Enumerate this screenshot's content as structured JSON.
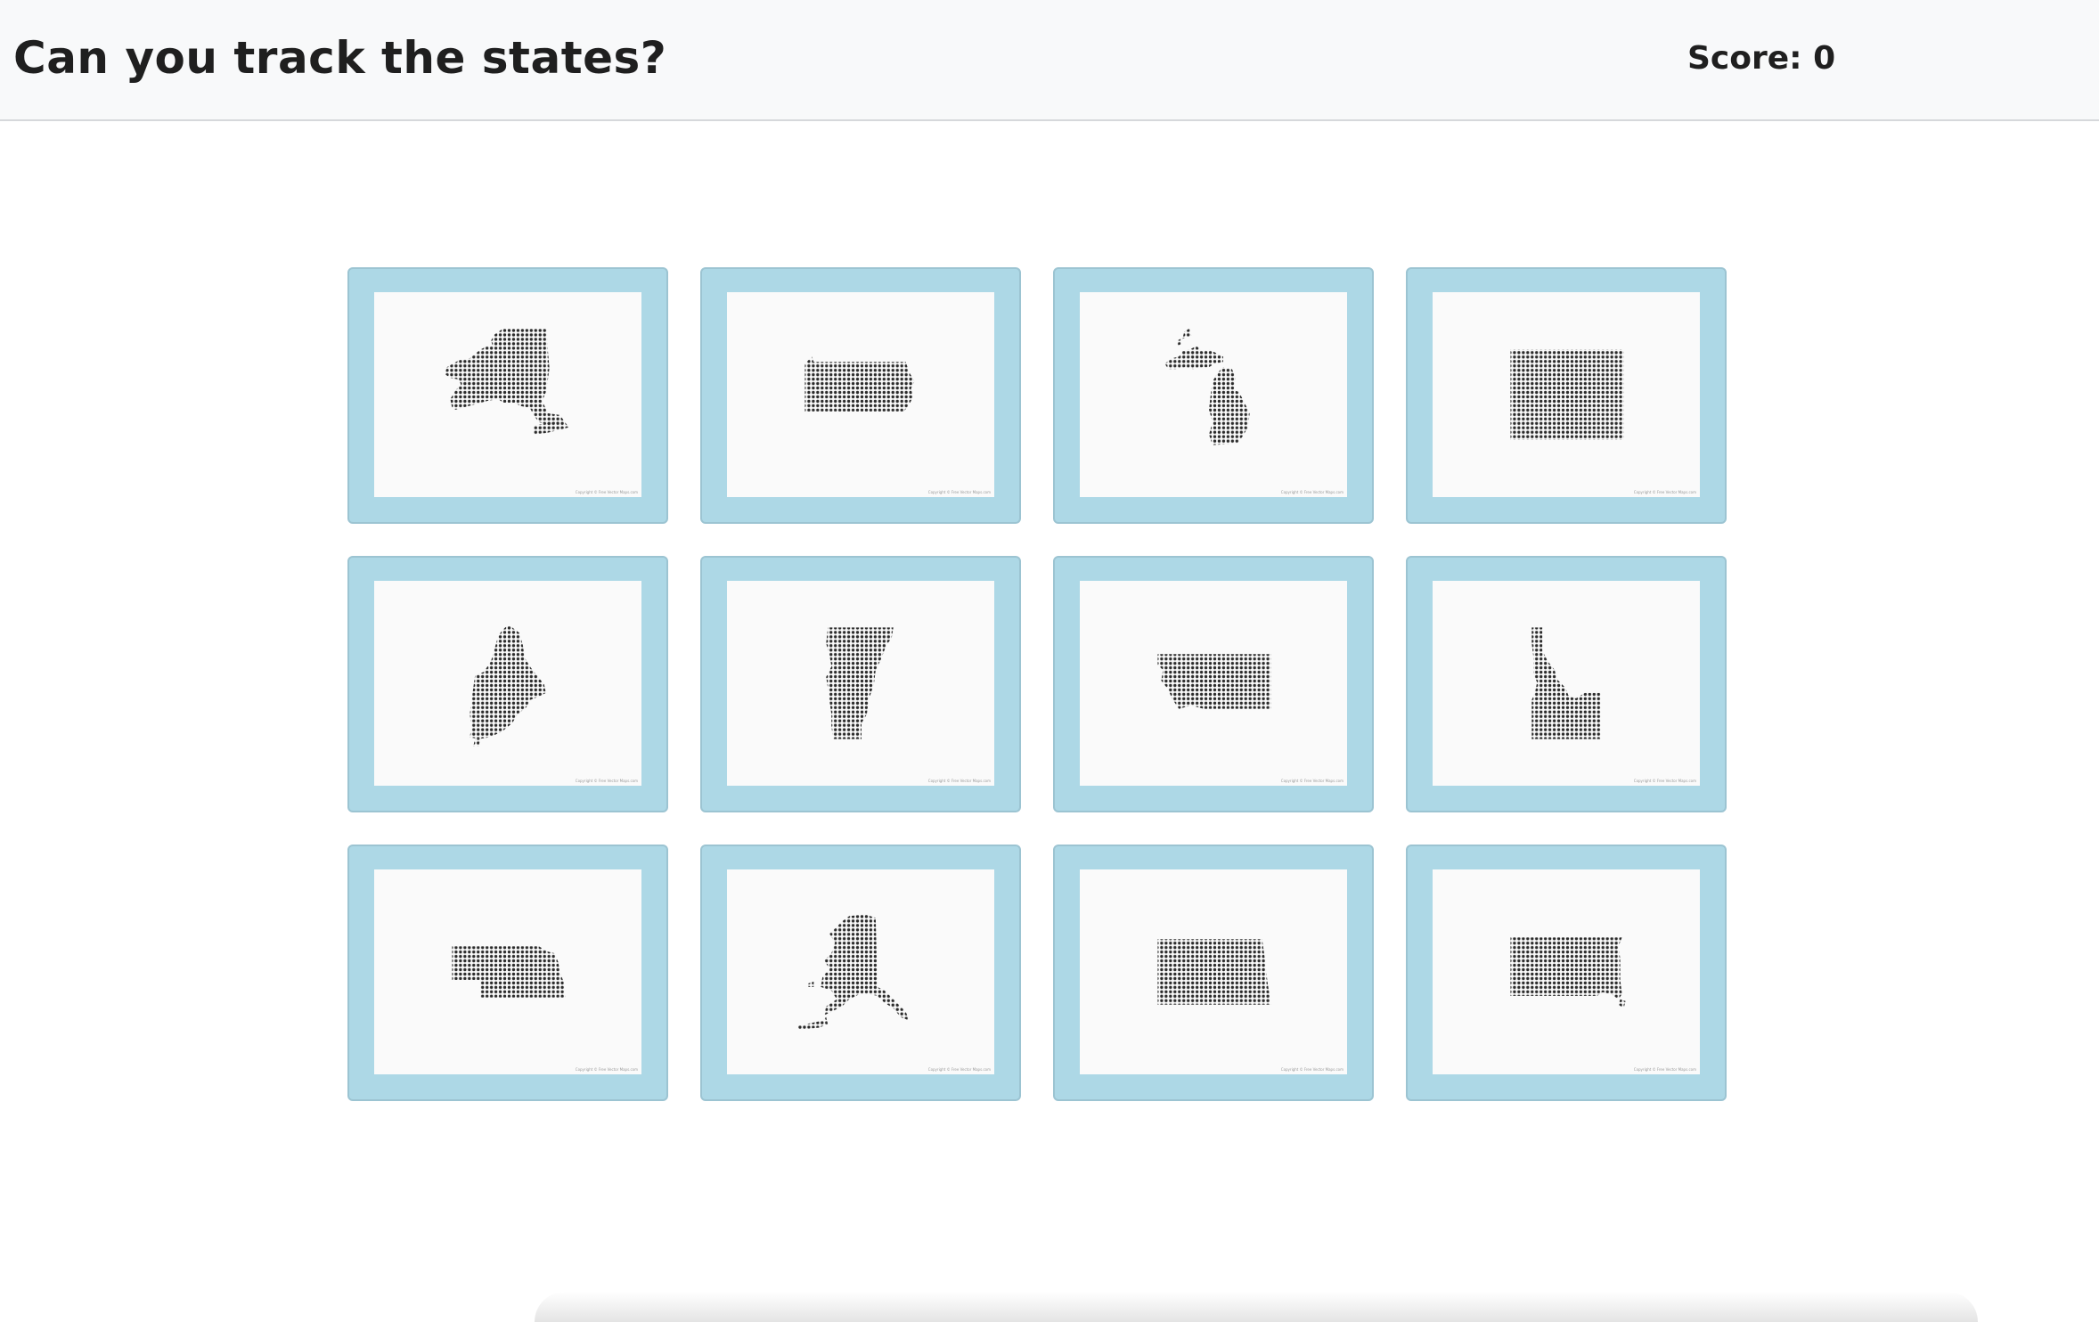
{
  "header": {
    "title": "Can you track the states?",
    "score_label": "Score: 0"
  },
  "game": {
    "cards": [
      {
        "state_icon": "new-york-icon",
        "copyright": "Copyright © Free Vector Maps.com"
      },
      {
        "state_icon": "pennsylvania-icon",
        "copyright": "Copyright © Free Vector Maps.com"
      },
      {
        "state_icon": "michigan-icon",
        "copyright": "Copyright © Free Vector Maps.com"
      },
      {
        "state_icon": "wyoming-icon",
        "copyright": "Copyright © Free Vector Maps.com"
      },
      {
        "state_icon": "maine-icon",
        "copyright": "Copyright © Free Vector Maps.com"
      },
      {
        "state_icon": "vermont-icon",
        "copyright": "Copyright © Free Vector Maps.com"
      },
      {
        "state_icon": "montana-icon",
        "copyright": "Copyright © Free Vector Maps.com"
      },
      {
        "state_icon": "idaho-icon",
        "copyright": "Copyright © Free Vector Maps.com"
      },
      {
        "state_icon": "nebraska-icon",
        "copyright": "Copyright © Free Vector Maps.com"
      },
      {
        "state_icon": "alaska-icon",
        "copyright": "Copyright © Free Vector Maps.com"
      },
      {
        "state_icon": "north-dakota-icon",
        "copyright": "Copyright © Free Vector Maps.com"
      },
      {
        "state_icon": "south-dakota-icon",
        "copyright": "Copyright © Free Vector Maps.com"
      }
    ]
  },
  "colors": {
    "card_border": "#add8e6",
    "card_face": "#fafafa",
    "dot": "#2b2b2b",
    "header_bg": "#f8f9fa"
  }
}
